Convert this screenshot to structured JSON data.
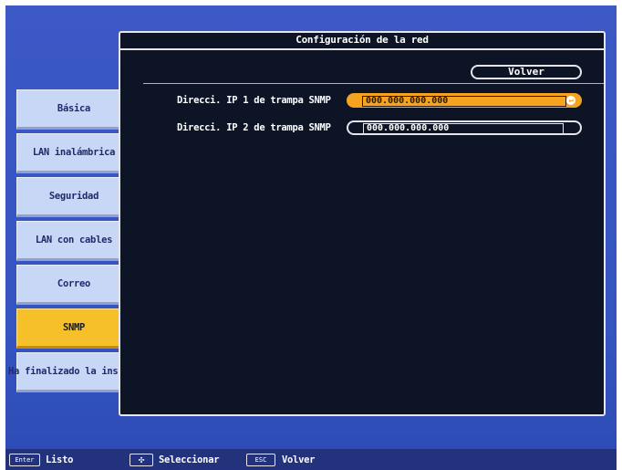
{
  "window": {
    "title": "Configuración de la red",
    "back_label": "Volver"
  },
  "fields": [
    {
      "label": "Direcci. IP 1 de trampa SNMP",
      "value": "000.000.000.000",
      "selected": true
    },
    {
      "label": "Direcci. IP 2 de trampa SNMP",
      "value": "000.000.000.000",
      "selected": false
    }
  ],
  "enter_icon": "enter-return-icon",
  "tabs": [
    {
      "label": "Básica"
    },
    {
      "label": "LAN inalámbrica"
    },
    {
      "label": "Seguridad"
    },
    {
      "label": "LAN con cables"
    },
    {
      "label": "Correo"
    },
    {
      "label": "SNMP",
      "active": true
    },
    {
      "label": "Ha finalizado la instalación"
    }
  ],
  "footer": {
    "enter_key": "Enter",
    "enter_text": "Listo",
    "move_key_icon": "four-way-arrow-icon",
    "move_text": "Seleccionar",
    "esc_key": "ESC",
    "esc_text": "Volver"
  },
  "colors": {
    "background": "#3454c0",
    "window": "#0d1425",
    "accent": "#f6a31f",
    "tab": "#c9d7f6",
    "tab_active": "#f6c02a"
  }
}
